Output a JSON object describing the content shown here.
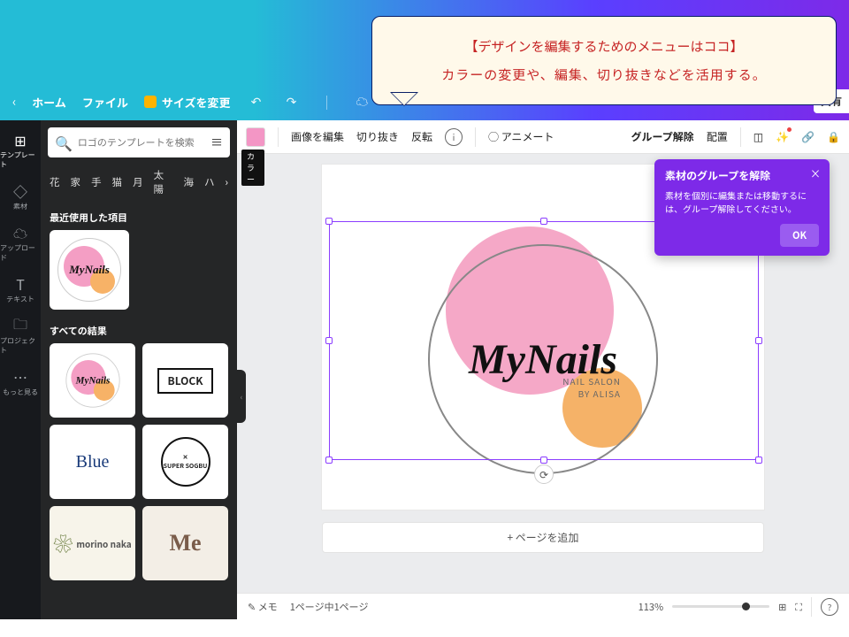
{
  "callout": {
    "line1": "【デザインを編集するためのメニューはココ】",
    "line2": "カラーの変更や、編集、切り抜きなどを活用する。"
  },
  "topbar": {
    "back": "‹",
    "home": "ホーム",
    "file": "ファイル",
    "resize": "サイズを変更",
    "share": "共有"
  },
  "sidebar": {
    "items": [
      {
        "icon": "⊞",
        "label": "テンプレート"
      },
      {
        "icon": "◇",
        "label": "素材"
      },
      {
        "icon": "☁",
        "label": "アップロード"
      },
      {
        "icon": "T",
        "label": "テキスト"
      },
      {
        "icon": "🗀",
        "label": "プロジェクト"
      },
      {
        "icon": "⋯",
        "label": "もっと見る"
      }
    ]
  },
  "panel": {
    "search_placeholder": "ロゴのテンプレートを検索",
    "tags": [
      "花",
      "家",
      "手",
      "猫",
      "月",
      "太陽",
      "海",
      "ハ"
    ],
    "recent_title": "最近使用した項目",
    "all_title": "すべての結果",
    "templates": [
      "MyNails",
      "BLOCK",
      "Blue",
      "SUPER SOGBU",
      "morino naka",
      "Me"
    ]
  },
  "ctx": {
    "color_label": "カラー",
    "edit_img": "画像を編集",
    "crop": "切り抜き",
    "flip": "反転",
    "animate": "アニメート",
    "ungroup": "グループ解除",
    "position": "配置"
  },
  "artwork": {
    "title": "MyNails",
    "sub1": "NAIL SALON",
    "sub2": "BY ALISA"
  },
  "popover": {
    "title": "素材のグループを解除",
    "body": "素材を個別に編集または移動するには、グループ解除してください。",
    "ok": "OK"
  },
  "addpage": "+ ページを追加",
  "footer": {
    "memo": "メモ",
    "page": "1ページ中1ページ",
    "zoom": "113%"
  }
}
